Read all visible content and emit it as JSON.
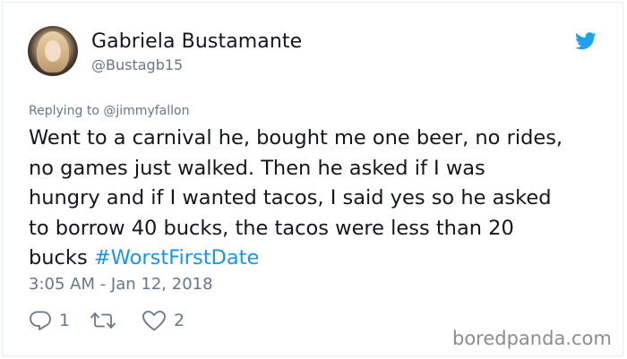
{
  "tweet": {
    "author_name": "Gabriela Bustamante",
    "author_handle": "@Bustagb15",
    "reply_prefix": "Replying to ",
    "reply_to": "@jimmyfallon",
    "text_lines": [
      "Went to a carnival he, bought me one beer, no rides,",
      "no games just walked. Then he asked if I was",
      "hungry and if I wanted tacos, I said yes so he asked",
      "to borrow 40 bucks, the tacos were less than 20"
    ],
    "last_line_text": "bucks ",
    "hashtag": "#WorstFirstDate",
    "timestamp": "3:05 AM - Jan 12, 2018",
    "reply_count": "1",
    "retweet_count": "",
    "like_count": "2"
  },
  "icons": {
    "brand": "twitter-bird-icon",
    "reply": "reply-icon",
    "retweet": "retweet-icon",
    "like": "heart-icon"
  },
  "colors": {
    "twitter_blue": "#1da1f2",
    "hashtag": "#1b95e0",
    "text": "#14171a",
    "secondary": "#657786"
  },
  "watermark": "boredpanda.com"
}
